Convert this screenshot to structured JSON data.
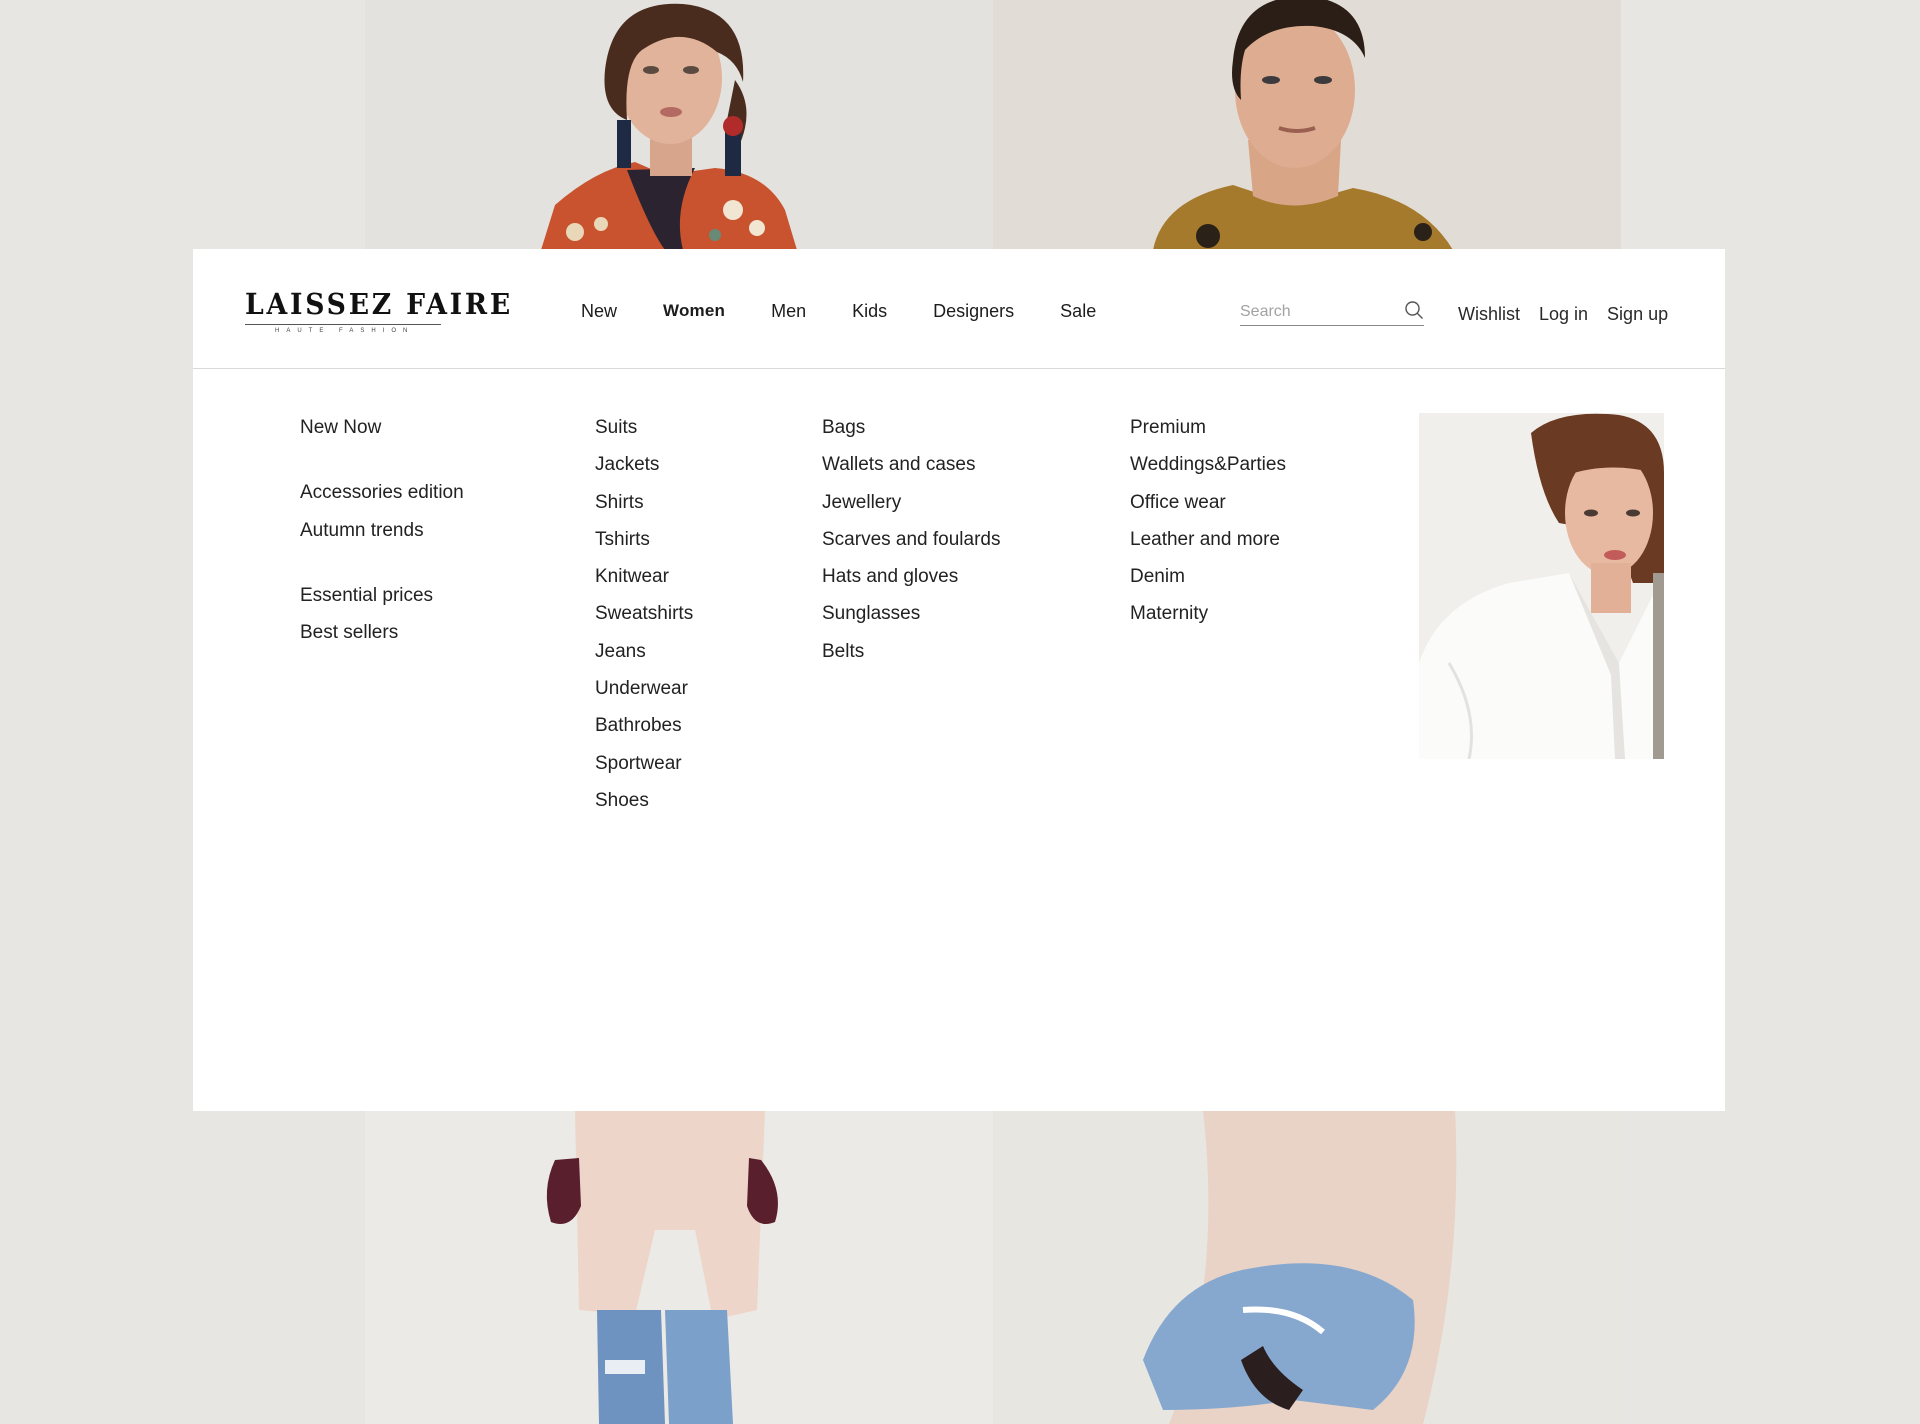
{
  "brand": {
    "name": "LAISSEZ FAIRE",
    "tagline": "HAUTE FASHION"
  },
  "nav": {
    "items": [
      {
        "label": "New",
        "active": false
      },
      {
        "label": "Women",
        "active": true
      },
      {
        "label": "Men",
        "active": false
      },
      {
        "label": "Kids",
        "active": false
      },
      {
        "label": "Designers",
        "active": false
      },
      {
        "label": "Sale",
        "active": false
      }
    ]
  },
  "search": {
    "placeholder": "Search",
    "value": ""
  },
  "account": {
    "wishlist": "Wishlist",
    "login": "Log in",
    "signup": "Sign up"
  },
  "menu": {
    "featured": {
      "group1": [
        "New Now"
      ],
      "group2": [
        "Accessories edition",
        "Autumn trends"
      ],
      "group3": [
        "Essential prices",
        "Best sellers"
      ]
    },
    "clothing": [
      "Suits",
      "Jackets",
      "Shirts",
      "Tshirts",
      "Knitwear",
      "Sweatshirts",
      "Jeans",
      "Underwear",
      "Bathrobes",
      "Sportwear",
      "Shoes"
    ],
    "accessories": [
      "Bags",
      "Wallets and cases",
      "Jewellery",
      "Scarves and foulards",
      "Hats and gloves",
      "Sunglasses",
      "Belts"
    ],
    "collections": [
      "Premium",
      "Weddings&Parties",
      "Office wear",
      "Leather and more",
      "Denim",
      "Maternity"
    ]
  },
  "colors": {
    "page_background": "#e7e6e2",
    "panel_background": "#ffffff",
    "text": "#1c1c1c",
    "divider": "#d9d9d9"
  }
}
